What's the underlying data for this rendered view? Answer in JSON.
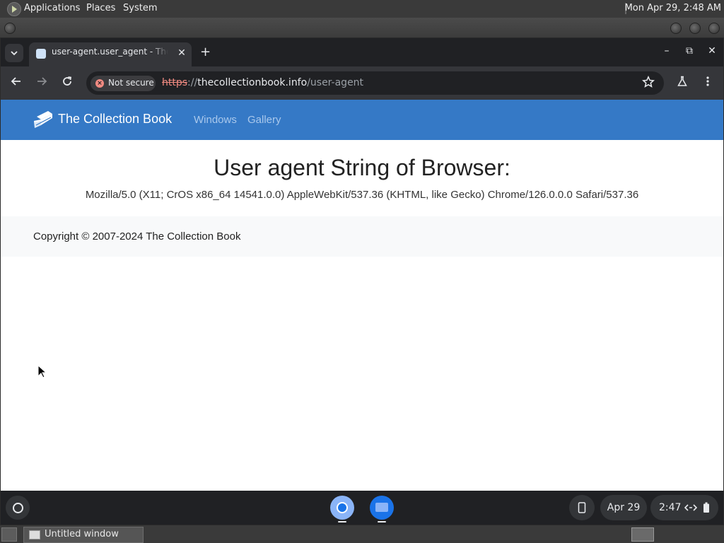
{
  "top_panel": {
    "menus": [
      "Applications",
      "Places",
      "System"
    ],
    "datetime": "Mon Apr 29,  2:48 AM"
  },
  "browser": {
    "tab": {
      "title": "user-agent.user_agent - The Collection Book",
      "close_glyph": "✕"
    },
    "new_tab_glyph": "+",
    "window_controls": {
      "minimize": "–",
      "restore": "⧉",
      "close": "✕"
    },
    "security_chip": "Not secure",
    "url": {
      "scheme": "https",
      "sep": "://",
      "host": "thecollectionbook.info",
      "path": "/user-agent"
    },
    "icons": {
      "back": "back-arrow-icon",
      "forward": "forward-arrow-icon",
      "reload": "reload-icon",
      "star": "star-icon",
      "labs": "flask-icon",
      "menu": "kebab-menu-icon"
    }
  },
  "page": {
    "brand": "The Collection Book",
    "nav_links": [
      "Windows",
      "Gallery"
    ],
    "heading": "User agent String of Browser:",
    "user_agent": "Mozilla/5.0 (X11; CrOS x86_64 14541.0.0) AppleWebKit/537.36 (KHTML, like Gecko) Chrome/126.0.0.0 Safari/537.36",
    "footer": "Copyright © 2007-2024 The Collection Book",
    "colors": {
      "navbar": "#3579c6",
      "nav_link": "#a9c8ec",
      "footer_bg": "#f8f9fa"
    }
  },
  "shelf": {
    "date": "Apr 29",
    "time": "2:47"
  },
  "bottom_bar": {
    "task": "Untitled window"
  }
}
